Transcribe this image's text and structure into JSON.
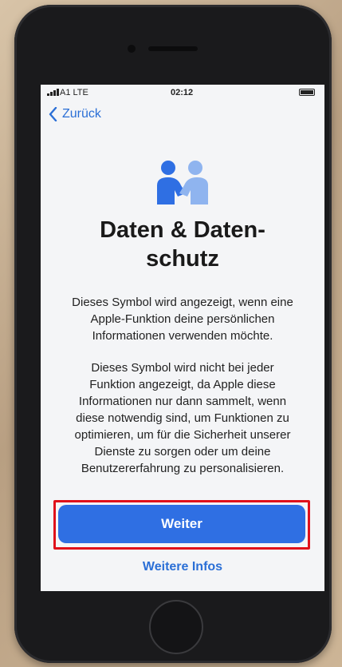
{
  "status_bar": {
    "carrier": "A1 LTE",
    "time": "02:12"
  },
  "nav": {
    "back_label": "Zurück"
  },
  "content": {
    "title_line1": "Daten & Daten-",
    "title_line2": "schutz",
    "paragraph1_lines": [
      "Dieses Symbol wird angezeigt, wenn eine",
      "Apple-Funktion deine persönlichen",
      "Informationen verwenden möchte."
    ],
    "paragraph2_lines": [
      "Dieses Symbol wird nicht bei jeder",
      "Funktion angezeigt, da Apple diese",
      "Informationen nur dann sammelt, wenn",
      "diese notwendig sind, um Funktionen zu",
      "optimieren, um für die Sicherheit unserer",
      "Dienste zu sorgen oder um deine",
      "Benutzererfahrung zu personalisieren."
    ]
  },
  "actions": {
    "continue_label": "Weiter",
    "more_info_label": "Weitere Infos"
  },
  "colors": {
    "accent": "#2f6fe3",
    "link": "#2b6fd6",
    "highlight": "#e0111b"
  },
  "icons": [
    "signal-icon",
    "battery-icon",
    "chevron-left-icon",
    "privacy-handshake-icon"
  ]
}
